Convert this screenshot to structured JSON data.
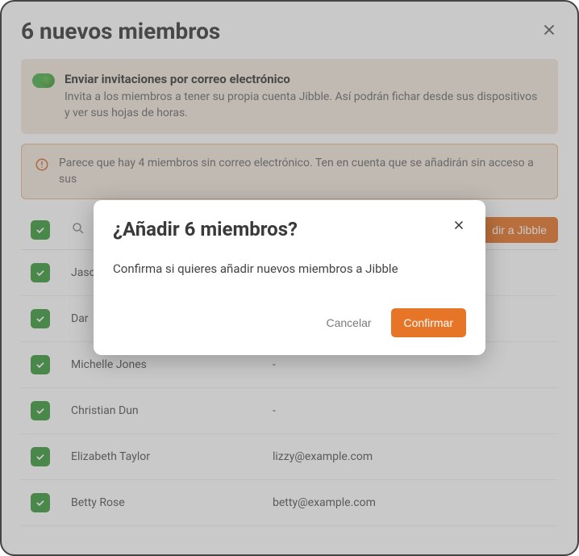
{
  "header": {
    "title": "6 nuevos miembros"
  },
  "email_invite": {
    "title": "Enviar invitaciones por correo electrónico",
    "desc": "Invita a los miembros a tener su propia cuenta Jibble. Así podrán fichar desde sus dispositivos y ver sus hojas de horas."
  },
  "warning": {
    "text": "Parece que hay 4 miembros sin correo electrónico. Ten en cuenta que se añadirán sin acceso a sus"
  },
  "add_button": "dir a Jibble",
  "rows": [
    {
      "name": "Jaso",
      "email": ""
    },
    {
      "name": "Dar",
      "email": ""
    },
    {
      "name": "Michelle Jones",
      "email": "-"
    },
    {
      "name": "Christian Dun",
      "email": "-"
    },
    {
      "name": "Elizabeth Taylor",
      "email": "lizzy@example.com"
    },
    {
      "name": "Betty Rose",
      "email": "betty@example.com"
    }
  ],
  "dialog": {
    "title": "¿Añadir 6 miembros?",
    "body": "Confirma si quieres añadir nuevos miembros a Jibble",
    "cancel": "Cancelar",
    "confirm": "Confirmar"
  }
}
